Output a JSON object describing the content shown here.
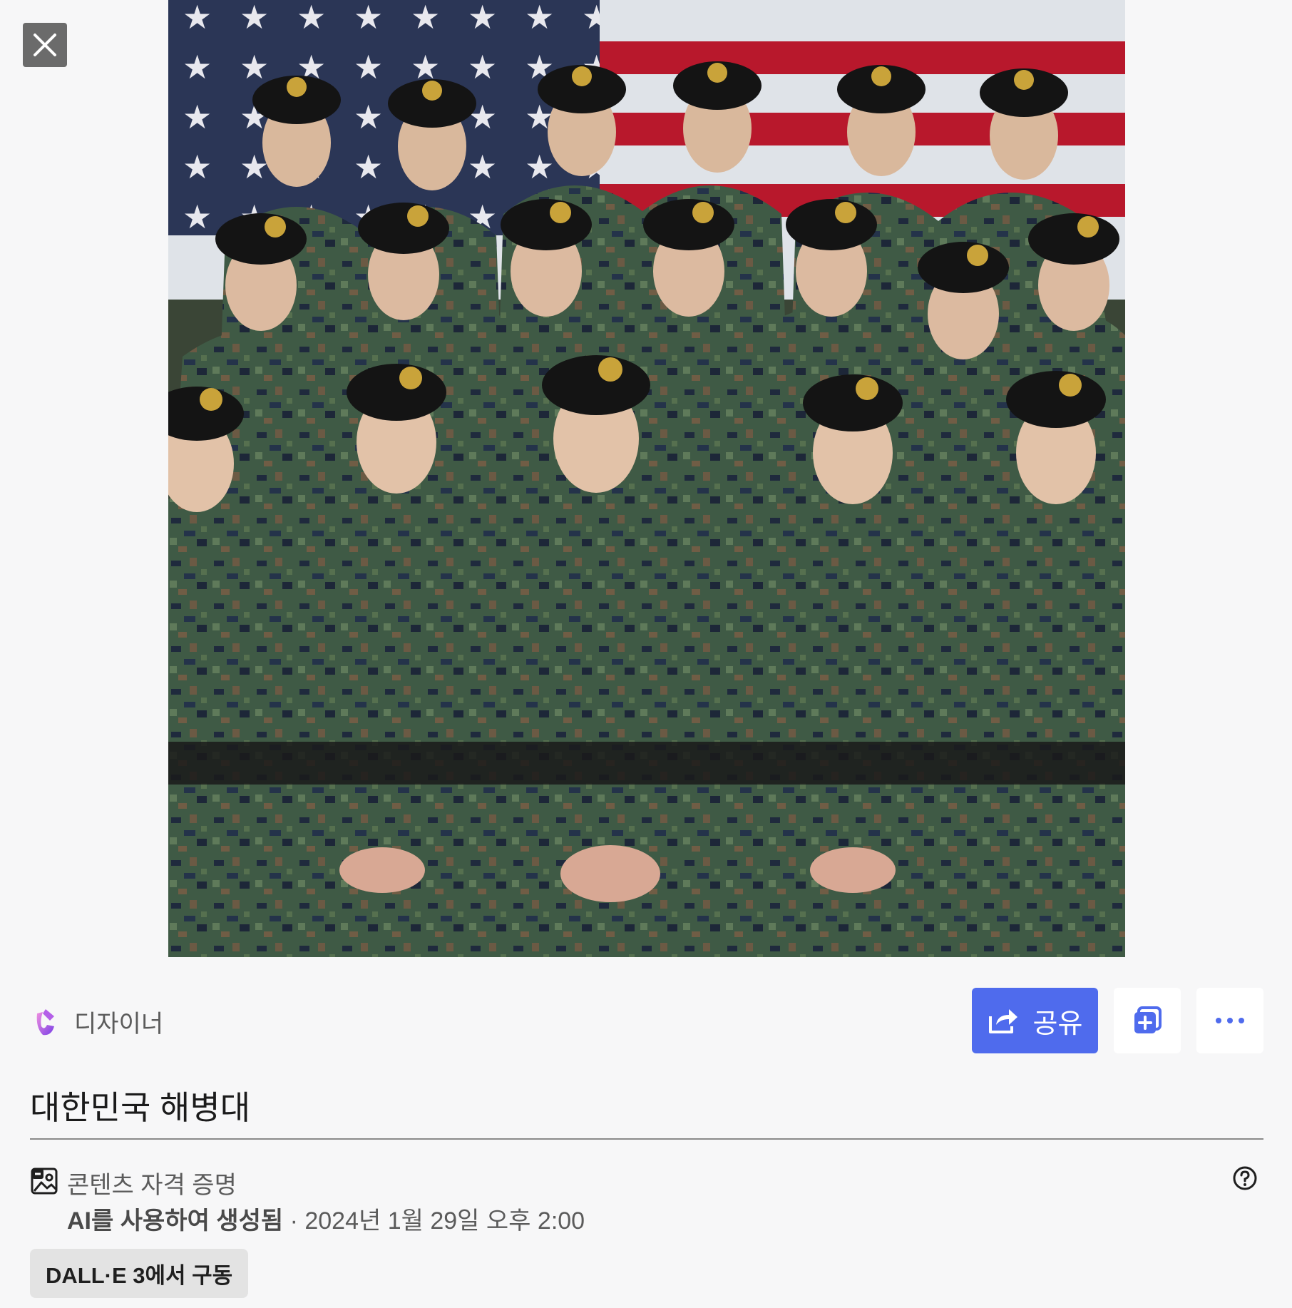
{
  "viewer": {
    "close_label": "close",
    "image_alt": "대한민국 해병대"
  },
  "creator": {
    "name": "디자이너",
    "logo_icon": "designer-logo-icon"
  },
  "actions": {
    "share_label": "공유",
    "share_icon": "share-icon",
    "add_icon": "add-to-collection-icon",
    "more_icon": "more-options-icon"
  },
  "title": "대한민국 해병대",
  "credentials": {
    "heading": "콘텐츠 자격 증명",
    "generated_by": "AI를 사용하여 생성됨",
    "separator": " · ",
    "timestamp": "2024년 1월 29일 오후 2:00"
  },
  "badge": "DALL·E 3에서 구동",
  "colors": {
    "accent": "#4f6bed",
    "background": "#f7f7f8",
    "close_bg": "#6b6b6b"
  }
}
